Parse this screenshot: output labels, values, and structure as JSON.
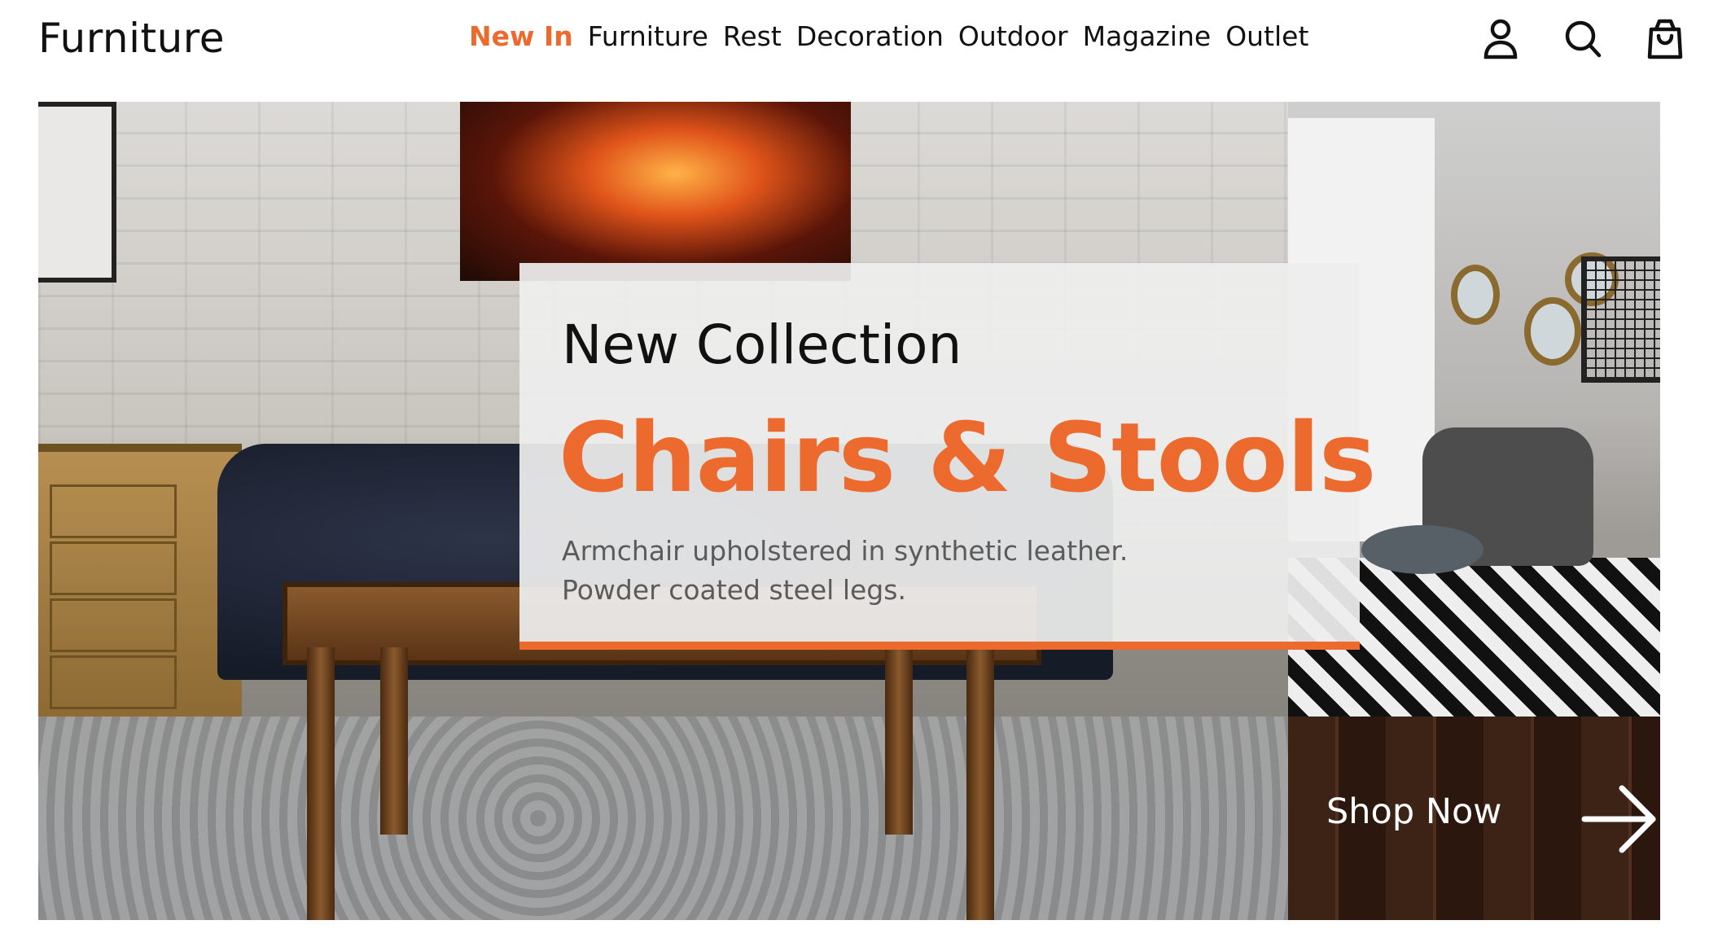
{
  "header": {
    "logo": "Furniture",
    "nav": [
      {
        "label": "New In",
        "active": true
      },
      {
        "label": "Furniture",
        "active": false
      },
      {
        "label": "Rest",
        "active": false
      },
      {
        "label": "Decoration",
        "active": false
      },
      {
        "label": "Outdoor",
        "active": false
      },
      {
        "label": "Magazine",
        "active": false
      },
      {
        "label": "Outlet",
        "active": false
      }
    ],
    "icons": [
      "user-icon",
      "search-icon",
      "shopping-bag-icon"
    ]
  },
  "hero": {
    "kicker": "New Collection",
    "title": "Chairs & Stools",
    "description_lines": [
      "Armchair upholstered in synthetic leather.",
      "Powder coated steel legs."
    ],
    "cta_label": "Shop Now",
    "cta_icon": "arrow-right-icon"
  },
  "colors": {
    "accent": "#ec6a2d",
    "text": "#111111",
    "muted_text": "#5b5b5b",
    "background": "#ffffff"
  }
}
